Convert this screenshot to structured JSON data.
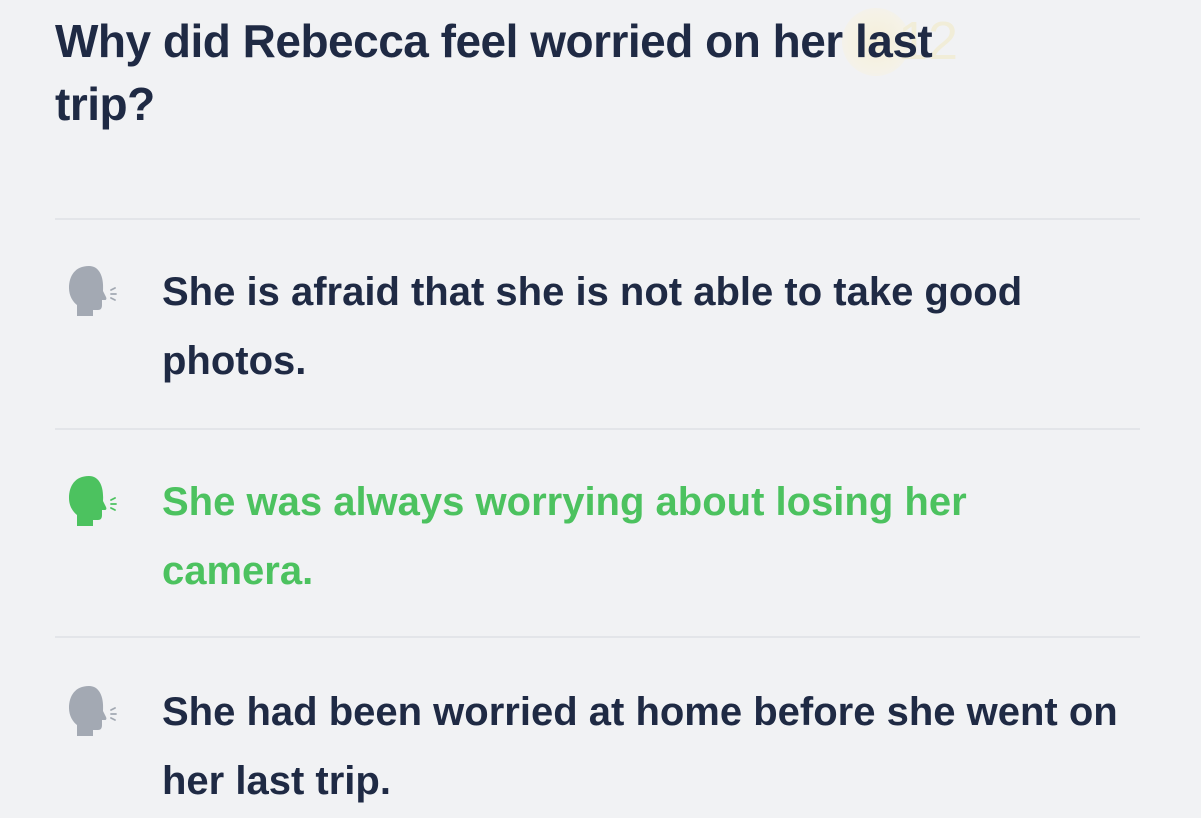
{
  "question": {
    "text": "Why did Rebecca feel worried on her last trip?",
    "badge_number": "12"
  },
  "options": [
    {
      "text": "She is afraid that she is not able to take good photos.",
      "state": "neutral",
      "icon": "speaking-head-icon"
    },
    {
      "text": "She was always worrying about losing her camera.",
      "state": "correct",
      "icon": "speaking-head-icon"
    },
    {
      "text": "She had been worried at home before she went on her last trip.",
      "state": "neutral",
      "icon": "speaking-head-icon"
    }
  ],
  "colors": {
    "text": "#1f2a44",
    "correct": "#4cc25f",
    "icon_neutral": "#a3a9b3",
    "background": "#f1f2f4",
    "divider": "#e3e5e9"
  }
}
